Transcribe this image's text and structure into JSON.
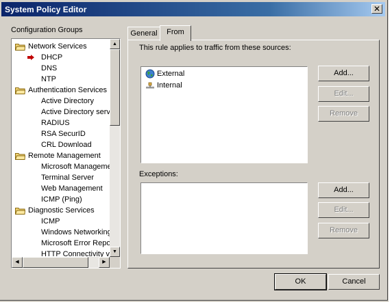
{
  "window": {
    "title": "System Policy Editor",
    "close_glyph": "✕"
  },
  "groups_label": "Configuration Groups",
  "tree": [
    {
      "label": "Network Services",
      "type": "folder"
    },
    {
      "label": "DHCP",
      "type": "selected-child"
    },
    {
      "label": "DNS",
      "type": "child"
    },
    {
      "label": "NTP",
      "type": "child"
    },
    {
      "label": "Authentication Services",
      "type": "folder"
    },
    {
      "label": "Active Directory",
      "type": "child"
    },
    {
      "label": "Active Directory serv",
      "type": "child"
    },
    {
      "label": "RADIUS",
      "type": "child"
    },
    {
      "label": "RSA SecurID",
      "type": "child"
    },
    {
      "label": "CRL Download",
      "type": "child"
    },
    {
      "label": "Remote Management",
      "type": "folder"
    },
    {
      "label": "Microsoft Manageme",
      "type": "child"
    },
    {
      "label": "Terminal Server",
      "type": "child"
    },
    {
      "label": "Web Management",
      "type": "child"
    },
    {
      "label": "ICMP (Ping)",
      "type": "child"
    },
    {
      "label": "Diagnostic Services",
      "type": "folder"
    },
    {
      "label": "ICMP",
      "type": "child"
    },
    {
      "label": "Windows Networking",
      "type": "child"
    },
    {
      "label": "Microsoft Error Repo",
      "type": "child"
    },
    {
      "label": "HTTP Connectivity ve",
      "type": "child"
    }
  ],
  "tabs": {
    "general": "General",
    "from": "From"
  },
  "from_tab": {
    "description": "This rule applies to traffic from these sources:",
    "sources": [
      {
        "label": "External",
        "icon": "globe-icon"
      },
      {
        "label": "Internal",
        "icon": "network-icon"
      }
    ],
    "exceptions_label": "Exceptions:"
  },
  "buttons": {
    "add": "Add...",
    "edit": "Edit...",
    "remove": "Remove",
    "ok": "OK",
    "cancel": "Cancel"
  },
  "scroll_glyphs": {
    "up": "▲",
    "down": "▼",
    "left": "◀",
    "right": "▶"
  },
  "colors": {
    "titlebar": "#0a246a",
    "face": "#d4d0c8",
    "selected_arrow": "#c00000"
  }
}
